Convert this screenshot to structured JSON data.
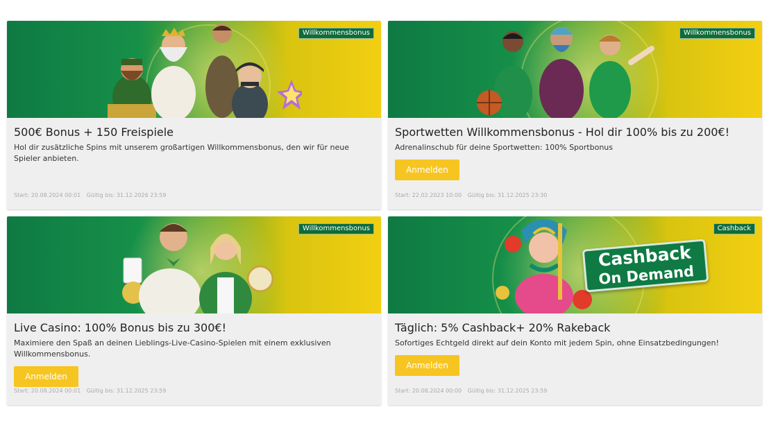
{
  "promos": [
    {
      "badge": "Willkommensbonus",
      "title": "500€ Bonus + 150 Freispiele",
      "description": "Hol dir zusätzliche Spins mit unserem großartigen Willkommensbonus, den wir für neue Spieler anbieten.",
      "start": "Start: 20.08.2024 00:01",
      "valid": "Gültig bis: 31.12.2026 23:59"
    },
    {
      "badge": "Willkommensbonus",
      "title": "Sportwetten Willkommensbonus - Hol dir 100% bis zu 200€!",
      "description": "Adrenalinschub für deine Sportwetten: 100% Sportbonus",
      "button": "Anmelden",
      "start": "Start: 22.02.2023 10:00",
      "valid": "Gültig bis: 31.12.2025 23:30"
    },
    {
      "badge": "Willkommensbonus",
      "title": "Live Casino: 100% Bonus bis zu 300€!",
      "description": "Maximiere den Spaß an deinen Lieblings-Live-Casino-Spielen mit einem exklusiven Willkommensbonus.",
      "button": "Anmelden",
      "start": "Start: 20.08.2024 00:01",
      "valid": "Gültig bis: 31.12.2025 23:59"
    },
    {
      "badge": "Cashback",
      "title": "Täglich: 5% Cashback+ 20% Rakeback",
      "description": "Sofortiges Echtgeld direkt auf dein Konto mit jedem Spin, ohne Einsatzbedingungen!",
      "button": "Anmelden",
      "start": "Start: 20.08.2024 00:00",
      "valid": "Gültig bis: 31.12.2025 23:59",
      "banner_text_line1": "Cashback",
      "banner_text_line2": "On Demand"
    }
  ],
  "colors": {
    "button": "#f7c521",
    "badge": "#0e6b3a",
    "banner_green": "#0f7a43",
    "banner_yellow": "#f2cf12"
  }
}
